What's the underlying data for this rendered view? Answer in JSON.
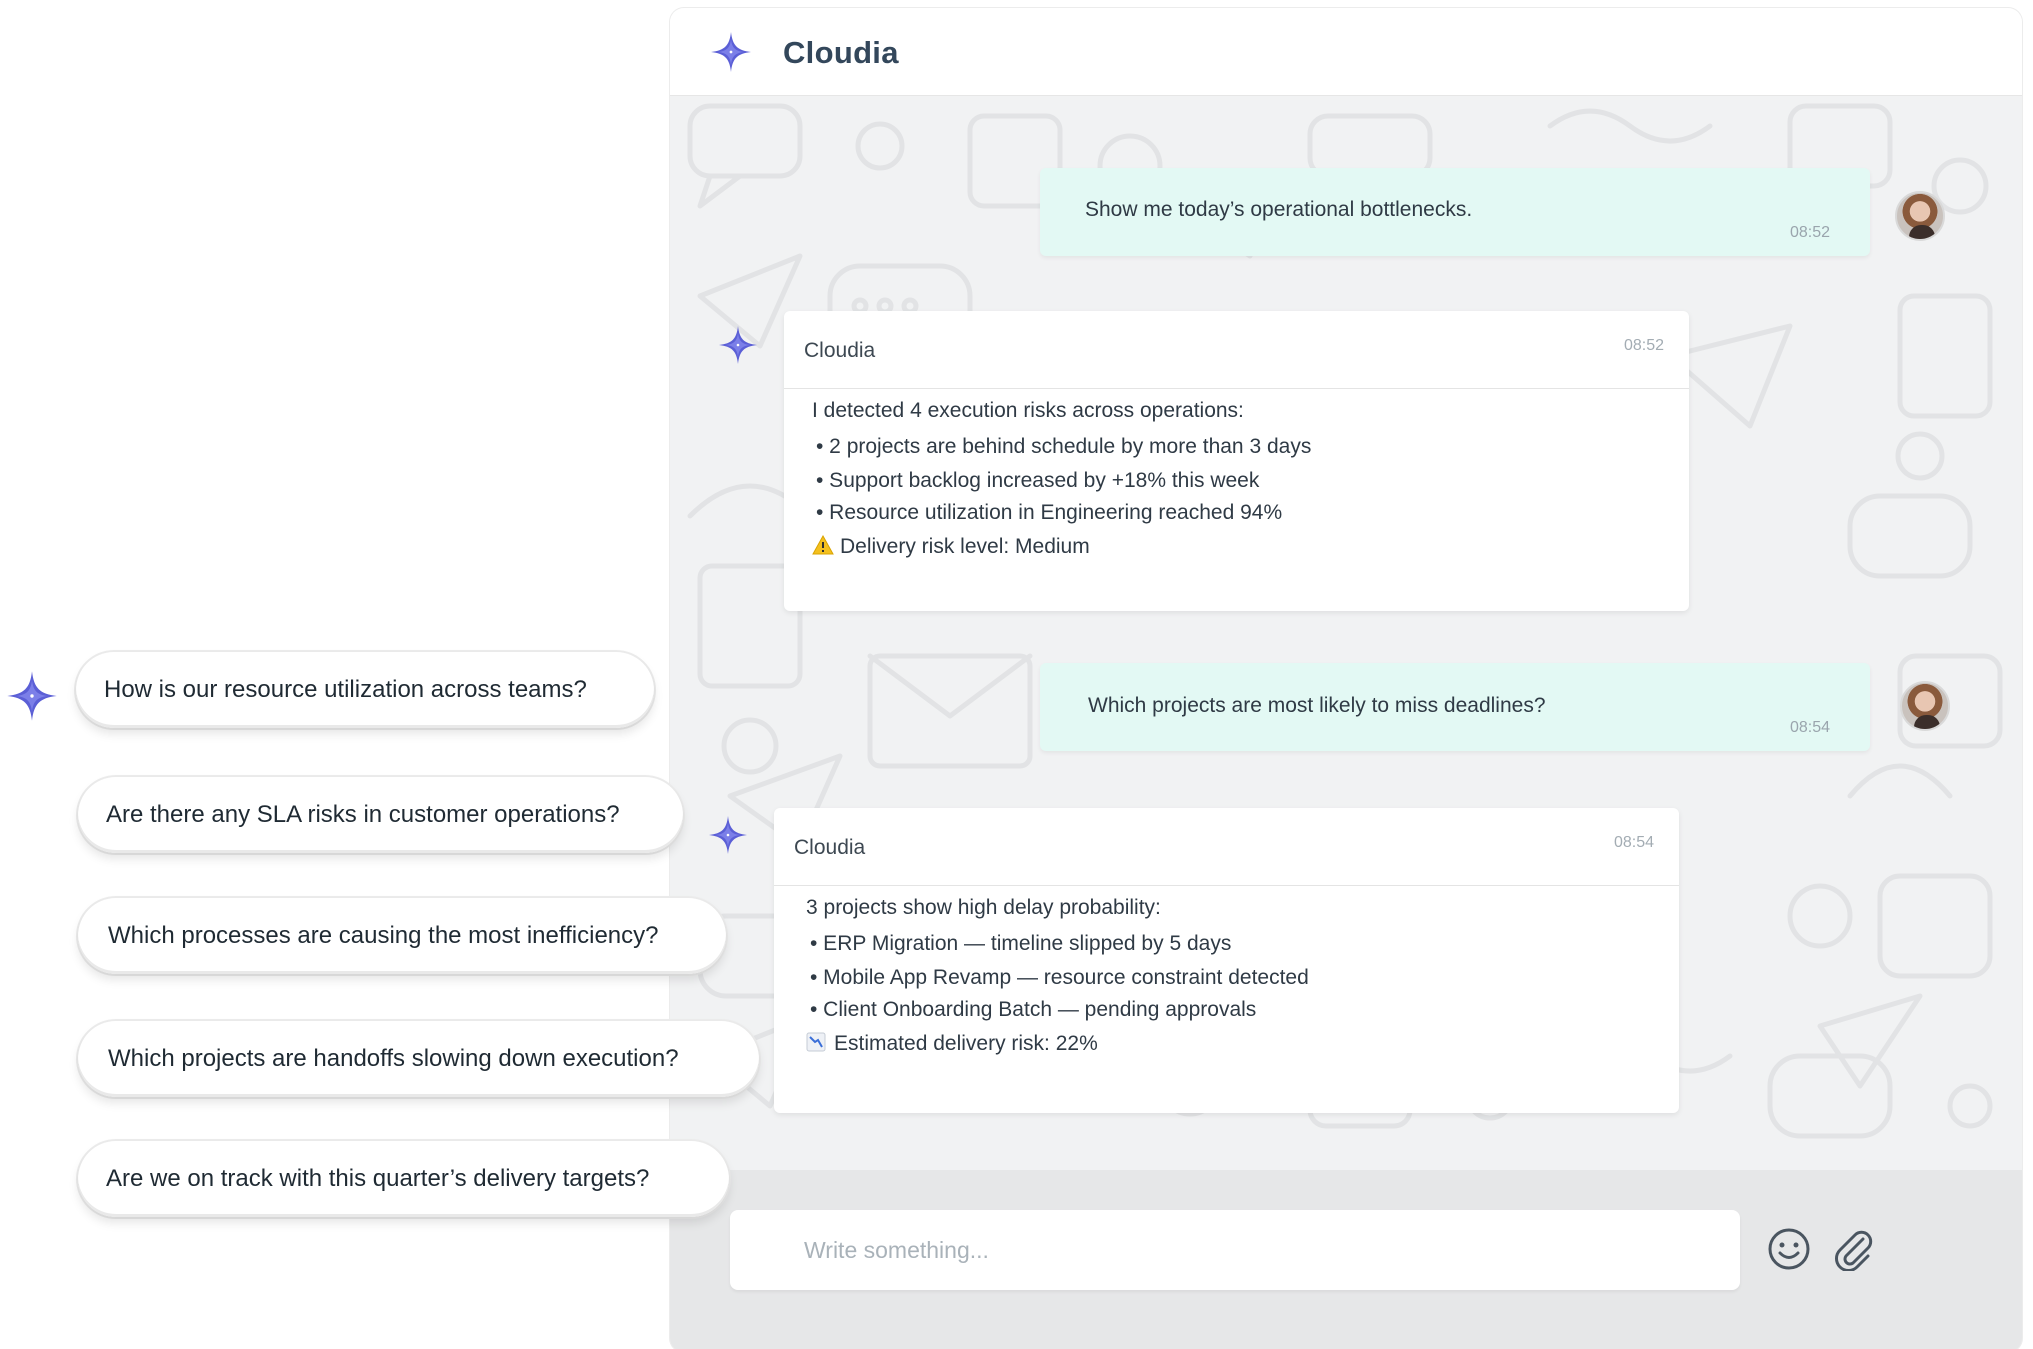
{
  "assistant": {
    "name": "Cloudia"
  },
  "messages": [
    {
      "role": "user",
      "text": "Show me today’s operational bottlenecks.",
      "time": "08:52"
    },
    {
      "role": "assistant",
      "sender": "Cloudia",
      "time": "08:52",
      "lines": [
        "I detected 4 execution risks across operations:",
        "• 2 projects are behind schedule by more than 3 days",
        "• Support backlog increased by +18% this week",
        "• Resource utilization in Engineering reached 94%",
        "Delivery risk level: Medium"
      ],
      "status_icon": "warning-icon"
    },
    {
      "role": "user",
      "text": "Which projects are most likely to miss deadlines?",
      "time": "08:54"
    },
    {
      "role": "assistant",
      "sender": "Cloudia",
      "time": "08:54",
      "lines": [
        "3 projects show high delay probability:",
        "• ERP Migration — timeline slipped by 5 days",
        "• Mobile App Revamp — resource constraint detected",
        "• Client Onboarding Batch — pending approvals",
        "Estimated delivery risk: 22%"
      ],
      "status_icon": "chart-decreasing-icon"
    }
  ],
  "composer": {
    "placeholder": "Write something..."
  },
  "suggestions": [
    "How is our resource utilization across teams?",
    "Are there any SLA risks in customer operations?",
    "Which processes are causing the most inefficiency?",
    "Which projects are handoffs slowing down execution?",
    "Are we on track with this quarter’s delivery targets?"
  ],
  "colors": {
    "accent_star": "#5b5fd6",
    "user_bubble": "#e3f9f4",
    "title": "#33475b",
    "chat_background": "#f1f2f3"
  }
}
